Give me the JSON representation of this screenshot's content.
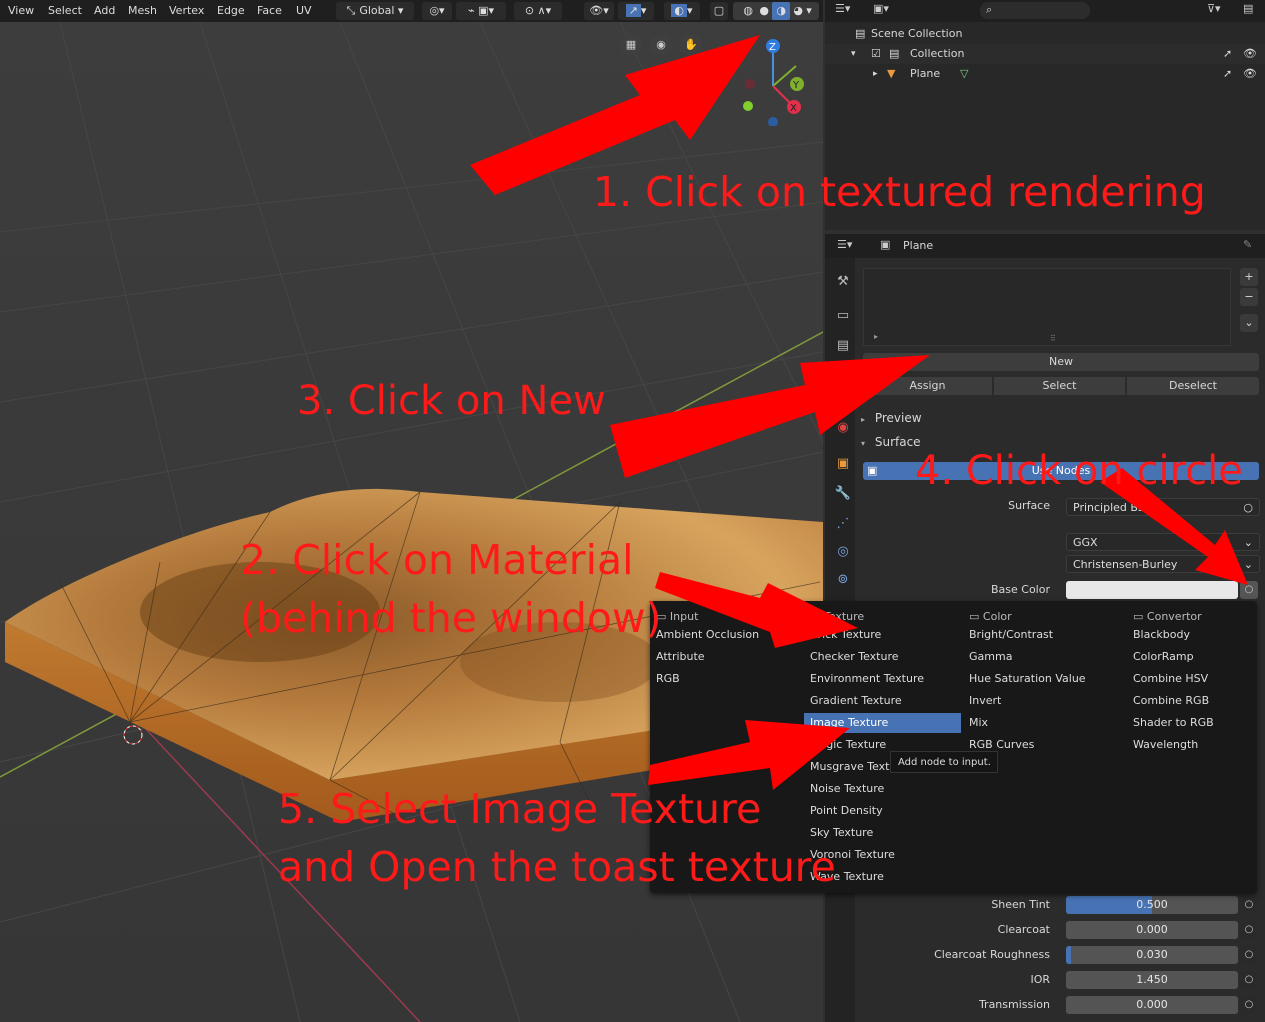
{
  "header": {
    "menus": [
      "View",
      "Select",
      "Add",
      "Mesh",
      "Vertex",
      "Edge",
      "Face",
      "UV"
    ],
    "orientation": "Global"
  },
  "outliner": {
    "root": "Scene Collection",
    "collection": "Collection",
    "object": "Plane"
  },
  "properties": {
    "object_name": "Plane",
    "material_buttons": {
      "new": "New",
      "assign": "Assign",
      "select": "Select",
      "deselect": "Deselect"
    },
    "panels": {
      "preview": "Preview",
      "surface": "Surface"
    },
    "use_nodes": "Use Nodes",
    "surface_label": "Surface",
    "surface_value": "Principled BSDF",
    "distribution": "GGX",
    "subsurface_method": "Christensen-Burley",
    "base_color_label": "Base Color",
    "rows": [
      {
        "label": "Sheen Tint",
        "value": "0.500",
        "fill": 0.5
      },
      {
        "label": "Clearcoat",
        "value": "0.000",
        "fill": 0.0
      },
      {
        "label": "Clearcoat Roughness",
        "value": "0.030",
        "fill": 0.03
      },
      {
        "label": "IOR",
        "value": "1.450",
        "fill": 0.0
      },
      {
        "label": "Transmission",
        "value": "0.000",
        "fill": 0.0
      }
    ]
  },
  "menu": {
    "input": {
      "title": "Input",
      "items": [
        "Ambient Occlusion",
        "Attribute",
        "RGB"
      ]
    },
    "texture": {
      "title": "Texture",
      "items": [
        "Brick Texture",
        "Checker Texture",
        "Environment Texture",
        "Gradient Texture",
        "Image Texture",
        "Magic Texture",
        "Musgrave Texture",
        "Noise Texture",
        "Point Density",
        "Sky Texture",
        "Voronoi Texture",
        "Wave Texture"
      ]
    },
    "color": {
      "title": "Color",
      "items": [
        "Bright/Contrast",
        "Gamma",
        "Hue Saturation Value",
        "Invert",
        "Mix",
        "RGB Curves"
      ]
    },
    "convertor": {
      "title": "Convertor",
      "items": [
        "Blackbody",
        "ColorRamp",
        "Combine HSV",
        "Combine RGB",
        "Shader to RGB",
        "Wavelength"
      ]
    },
    "tooltip": "Add node to input."
  },
  "annotations": {
    "step1": "1. Click on textured rendering",
    "step2a": "2. Click on Material",
    "step2b": "(behind the window)",
    "step3": "3. Click on New",
    "step4": "4. Click on circle",
    "step5a": "5. Select Image Texture",
    "step5b": "and Open the toast texture"
  },
  "colors": {
    "accent": "#4772b3",
    "annotation": "#ff1a1a",
    "toast": "#c98a3e"
  },
  "icons": [
    "search-icon",
    "filter-icon",
    "eye-icon",
    "cursor-icon",
    "camera-icon",
    "hand-icon",
    "grid-icon",
    "gear-icon"
  ]
}
